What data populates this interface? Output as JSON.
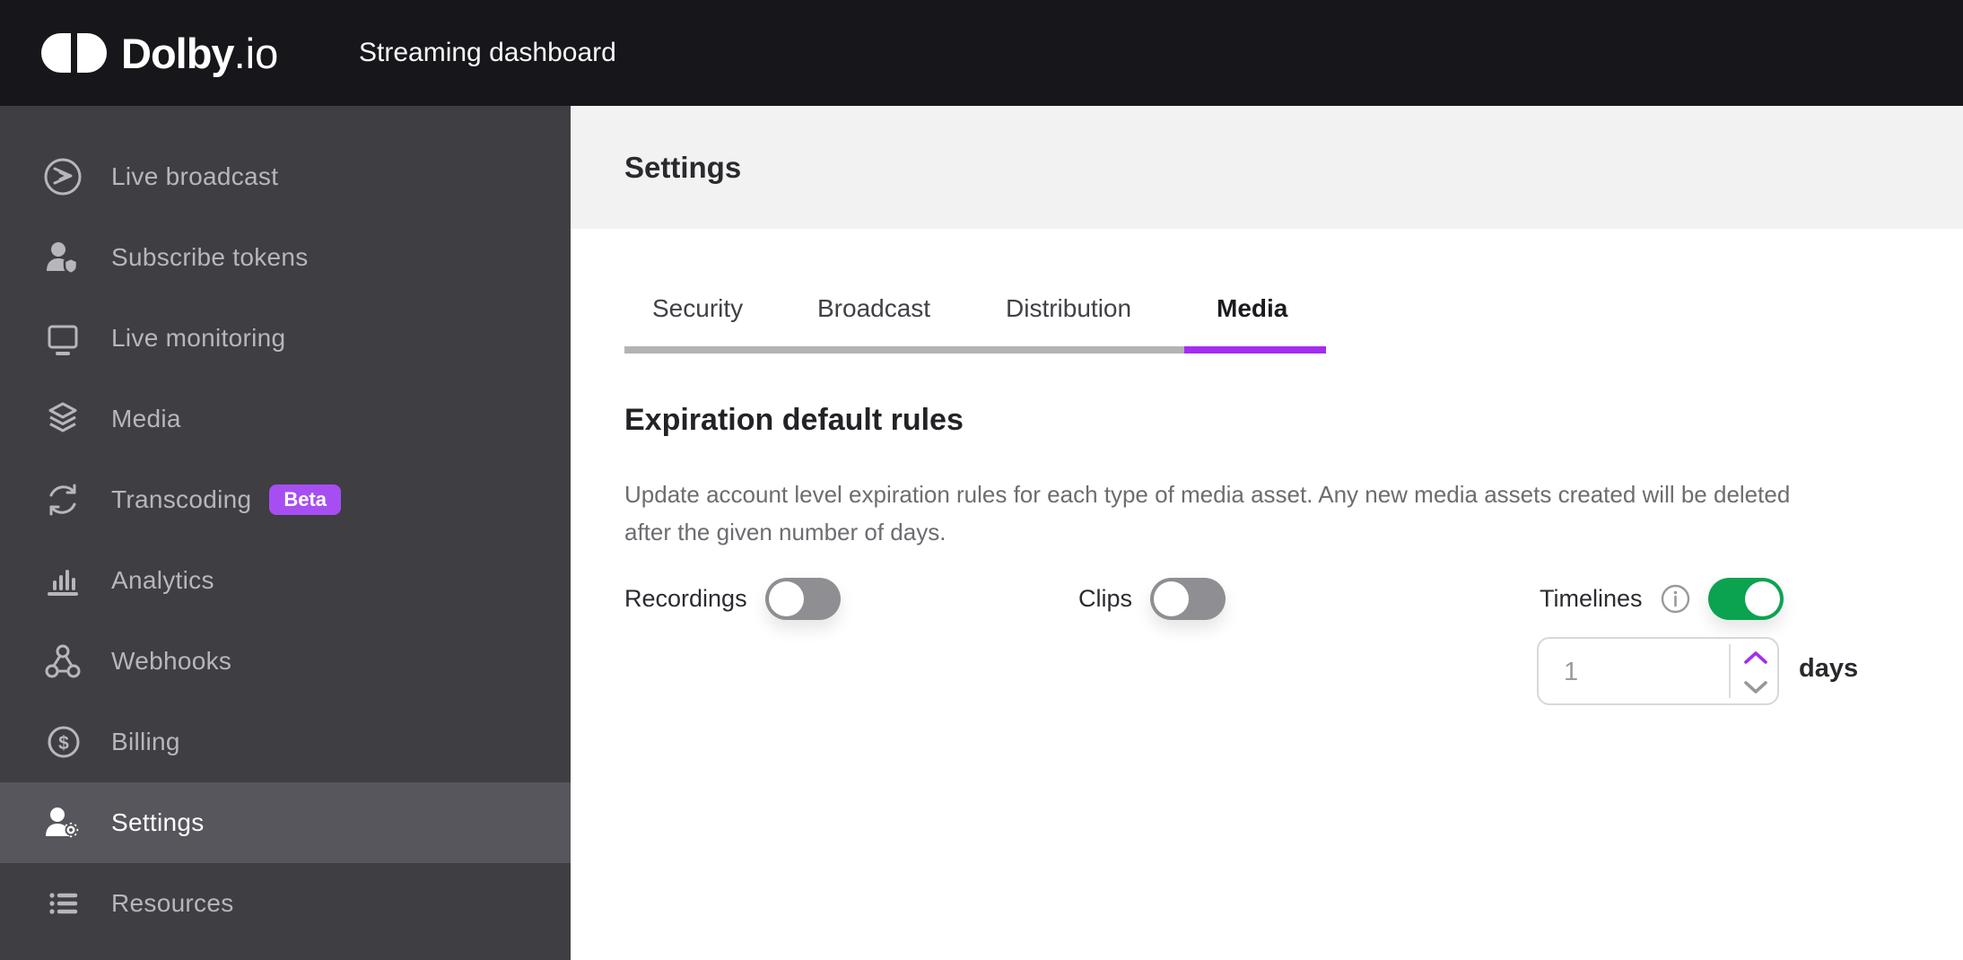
{
  "topbar": {
    "logo_text": "Dolby",
    "logo_suffix": ".io",
    "app_title": "Streaming dashboard"
  },
  "sidebar": {
    "items": [
      {
        "label": "Live broadcast",
        "icon": "live-broadcast-icon",
        "selected": false
      },
      {
        "label": "Subscribe tokens",
        "icon": "subscribe-tokens-icon",
        "selected": false
      },
      {
        "label": "Live monitoring",
        "icon": "live-monitoring-icon",
        "selected": false
      },
      {
        "label": "Media",
        "icon": "media-icon",
        "selected": false
      },
      {
        "label": "Transcoding",
        "icon": "transcoding-icon",
        "selected": false,
        "badge": "Beta"
      },
      {
        "label": "Analytics",
        "icon": "analytics-icon",
        "selected": false
      },
      {
        "label": "Webhooks",
        "icon": "webhooks-icon",
        "selected": false
      },
      {
        "label": "Billing",
        "icon": "billing-icon",
        "selected": false
      },
      {
        "label": "Settings",
        "icon": "settings-icon",
        "selected": true
      },
      {
        "label": "Resources",
        "icon": "resources-icon",
        "selected": false
      }
    ]
  },
  "page": {
    "title": "Settings"
  },
  "tabs": {
    "items": [
      {
        "label": "Security"
      },
      {
        "label": "Broadcast"
      },
      {
        "label": "Distribution"
      },
      {
        "label": "Media"
      }
    ],
    "active_label": "Media"
  },
  "content": {
    "heading": "Expiration default rules",
    "description": "Update account level expiration rules for each type of media asset. Any new media assets created will be deleted after the given number of days.",
    "toggles": [
      {
        "label": "Recordings",
        "state": "off"
      },
      {
        "label": "Clips",
        "state": "off"
      },
      {
        "label": "Timelines",
        "state": "on",
        "has_info_icon": true
      }
    ],
    "expiration": {
      "value": "1",
      "unit": "days"
    }
  },
  "colors": {
    "accent_purple": "#a32df2",
    "badge_purple": "#a64ef2",
    "toggle_on_green": "#0ca350",
    "toggle_off_gray": "#8e8e93",
    "topbar_bg": "#17161b",
    "sidebar_bg": "#3e3e43",
    "sidebar_selected_bg": "#56565c",
    "header_band_bg": "#f2f2f3",
    "inactive_tab_underline": "#b3b3b3"
  }
}
